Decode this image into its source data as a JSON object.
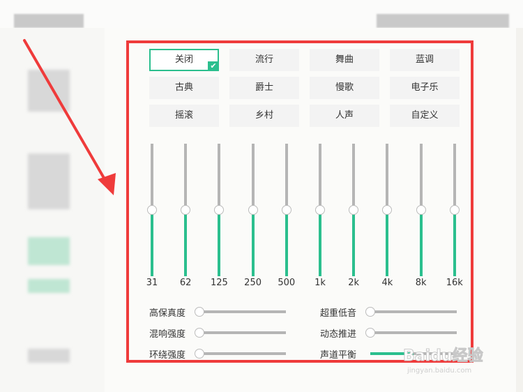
{
  "presets": [
    {
      "label": "关闭",
      "selected": true
    },
    {
      "label": "流行"
    },
    {
      "label": "舞曲"
    },
    {
      "label": "蓝调"
    },
    {
      "label": "古典"
    },
    {
      "label": "爵士"
    },
    {
      "label": "慢歌"
    },
    {
      "label": "电子乐"
    },
    {
      "label": "摇滚"
    },
    {
      "label": "乡村"
    },
    {
      "label": "人声"
    },
    {
      "label": "自定义"
    }
  ],
  "check_icon": "✔",
  "eq_bands": [
    {
      "freq": "31",
      "level": 0.5
    },
    {
      "freq": "62",
      "level": 0.5
    },
    {
      "freq": "125",
      "level": 0.5
    },
    {
      "freq": "250",
      "level": 0.5
    },
    {
      "freq": "500",
      "level": 0.5
    },
    {
      "freq": "1k",
      "level": 0.5
    },
    {
      "freq": "2k",
      "level": 0.5
    },
    {
      "freq": "4k",
      "level": 0.5
    },
    {
      "freq": "8k",
      "level": 0.5
    },
    {
      "freq": "16k",
      "level": 0.5
    }
  ],
  "effects": [
    {
      "label": "高保真度",
      "level": 0
    },
    {
      "label": "超重低音",
      "level": 0
    },
    {
      "label": "混响强度",
      "level": 0
    },
    {
      "label": "动态推进",
      "level": 0
    },
    {
      "label": "环绕强度",
      "level": 0
    },
    {
      "label": "声道平衡",
      "level": 0.5
    }
  ],
  "colors": {
    "accent": "#2bbf8e",
    "highlight": "#ef3b3b",
    "track": "#b5b5b5"
  },
  "watermark": {
    "main": "Baidu经验",
    "sub": "jingyan.baidu.com"
  }
}
